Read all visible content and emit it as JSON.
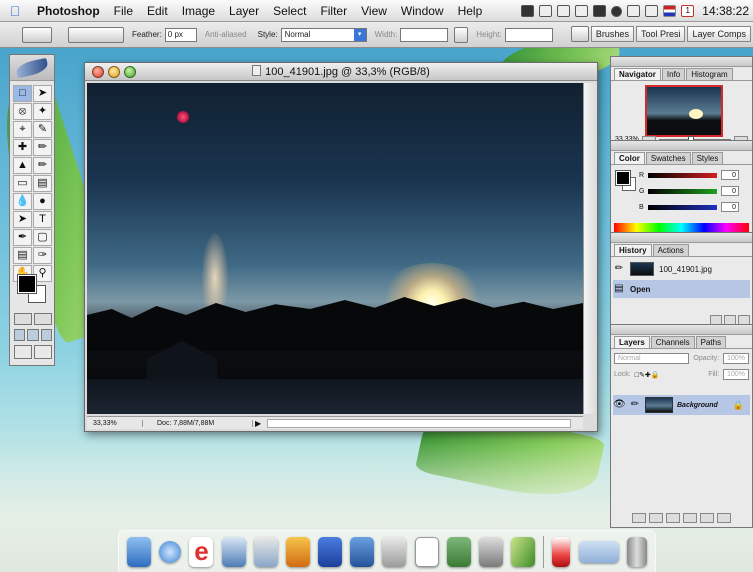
{
  "menubar": {
    "app": "Photoshop",
    "items": [
      "File",
      "Edit",
      "Image",
      "Layer",
      "Select",
      "Filter",
      "View",
      "Window",
      "Help"
    ],
    "clock": "14:38:22",
    "status_icons": [
      "screen-icon",
      "envelope-icon",
      "mail-icon",
      "network-icon",
      "battery-icon",
      "record-icon",
      "display-mirror-icon",
      "airport-icon",
      "flag-icon",
      "calendar-icon"
    ]
  },
  "optionsbar": {
    "feather_label": "Feather:",
    "feather_value": "0 px",
    "antialiased": "Anti-aliased",
    "style_label": "Style:",
    "style_value": "Normal",
    "width_label": "Width:",
    "height_label": "Height:",
    "wells": [
      "Brushes",
      "Tool Presi",
      "Layer Comps"
    ]
  },
  "document": {
    "title": "100_41901.jpg @ 33,3% (RGB/8)",
    "zoom": "33,33%",
    "doc_size": "Doc: 7,88M/7,88M"
  },
  "navigator": {
    "tabs": [
      "Navigator",
      "Info",
      "Histogram"
    ],
    "zoom": "33,33%"
  },
  "color": {
    "tabs": [
      "Color",
      "Swatches",
      "Styles"
    ],
    "channels": [
      {
        "label": "R",
        "value": "0",
        "color": "#d02020"
      },
      {
        "label": "G",
        "value": "0",
        "color": "#20a020"
      },
      {
        "label": "B",
        "value": "0",
        "color": "#2030c0"
      }
    ]
  },
  "history": {
    "tabs": [
      "History",
      "Actions"
    ],
    "snapshot": "100_41901.jpg",
    "state": "Open"
  },
  "layers": {
    "tabs": [
      "Layers",
      "Channels",
      "Paths"
    ],
    "blend": "Normal",
    "opacity_label": "Opacity:",
    "opacity_value": "100%",
    "lock_label": "Lock:",
    "fill_label": "Fill:",
    "fill_value": "100%",
    "layer_name": "Background"
  },
  "tools": [
    "marquee",
    "move",
    "lasso",
    "magic-wand",
    "crop",
    "slice",
    "healing",
    "brush",
    "stamp",
    "history-brush",
    "eraser",
    "gradient",
    "blur",
    "dodge",
    "path-select",
    "type",
    "pen",
    "shape",
    "notes",
    "eyedropper",
    "hand",
    "zoom"
  ],
  "dock_items": [
    "finder-icon",
    "iphoto-icon",
    "internet-explorer-icon",
    "mail-icon",
    "ichat-icon",
    "photoshop-icon",
    "word-icon",
    "book-icon",
    "pen-icon",
    "textedit-icon",
    "printer-icon",
    "utility-icon",
    "feather-icon",
    "cup-icon",
    "window-icon",
    "trash-icon"
  ]
}
